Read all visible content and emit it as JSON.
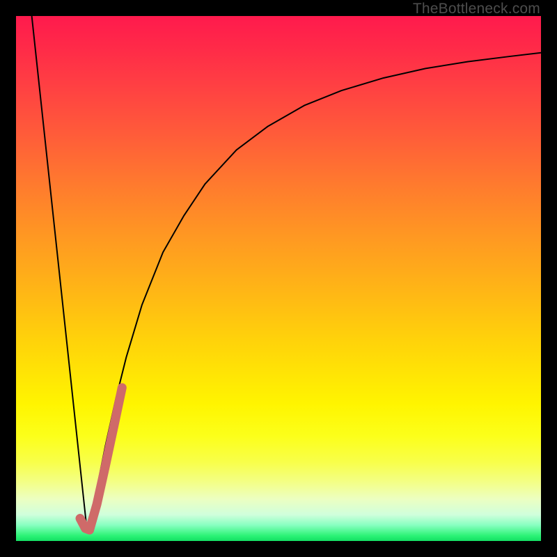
{
  "watermark": "TheBottleneck.com",
  "chart_data": {
    "type": "line",
    "title": "",
    "xlabel": "",
    "ylabel": "",
    "xlim": [
      0,
      100
    ],
    "ylim": [
      0,
      100
    ],
    "grid": false,
    "legend": false,
    "series": [
      {
        "name": "descent",
        "color": "#000000",
        "width": 2,
        "x": [
          3,
          13.5
        ],
        "values": [
          100,
          2.2
        ]
      },
      {
        "name": "ascent",
        "color": "#000000",
        "width": 2,
        "x": [
          13.8,
          15,
          17,
          19,
          21,
          24,
          28,
          32,
          36,
          42,
          48,
          55,
          62,
          70,
          78,
          86,
          94,
          100
        ],
        "values": [
          2.2,
          8,
          18,
          27,
          35,
          45,
          55,
          62,
          68,
          74.5,
          79,
          83,
          85.8,
          88.2,
          90,
          91.3,
          92.3,
          93
        ]
      },
      {
        "name": "marker",
        "color": "#cf6a69",
        "width": 13,
        "x": [
          12.2,
          13.2,
          14.0,
          15.4,
          17.0,
          18.8,
          20.2
        ],
        "values": [
          4.3,
          2.4,
          2.1,
          7.0,
          14.2,
          22.6,
          29.2
        ]
      }
    ],
    "background_gradient": {
      "stops": [
        {
          "pos": 0,
          "color": "#ff1a4d"
        },
        {
          "pos": 74,
          "color": "#fff500"
        },
        {
          "pos": 99,
          "color": "#2cf376"
        },
        {
          "pos": 100,
          "color": "#13df63"
        }
      ]
    }
  }
}
